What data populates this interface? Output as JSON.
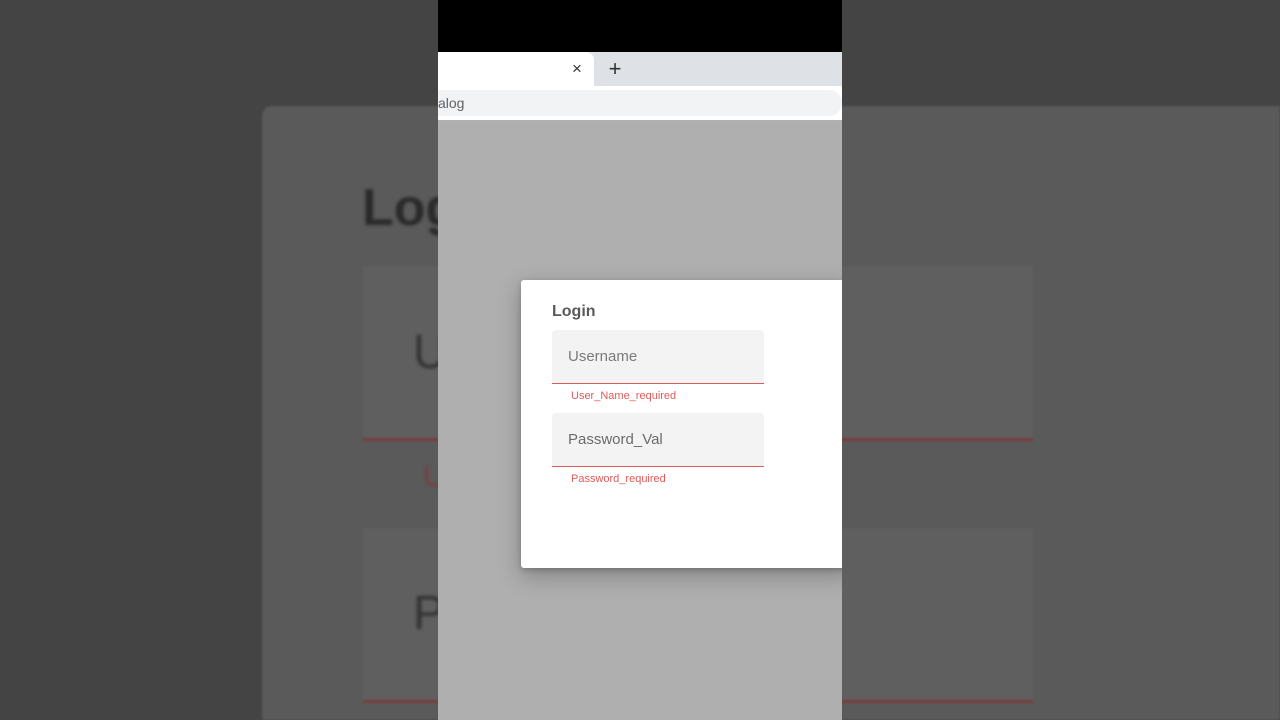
{
  "background": {
    "title_fragment": "Log",
    "field1_fragment": "U",
    "error_fragment": "U",
    "field2_fragment": "P"
  },
  "browser": {
    "close_glyph": "×",
    "newtab_glyph": "+",
    "address_text": "alog"
  },
  "dialog": {
    "title": "Login",
    "username": {
      "placeholder": "Username",
      "value": "",
      "error": "User_Name_required"
    },
    "password": {
      "placeholder": "",
      "value": "Password_Val",
      "error": "Password_required"
    }
  },
  "colors": {
    "error": "#e05a5a",
    "field_bg": "#f3f3f3"
  }
}
